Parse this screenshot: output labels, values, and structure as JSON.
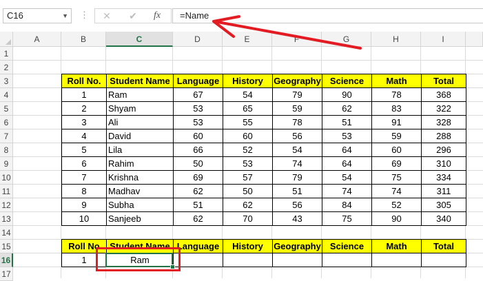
{
  "formula_bar": {
    "name_box": "C16",
    "name_box_dropdown_icon": "chevron-down-icon",
    "more_icon": "vertical-dots-icon",
    "cancel_icon": "close-icon",
    "enter_icon": "check-icon",
    "fx_label": "fx",
    "formula": "=Name"
  },
  "columns": [
    "A",
    "B",
    "C",
    "D",
    "E",
    "F",
    "G",
    "H",
    "I"
  ],
  "rows": [
    "1",
    "2",
    "3",
    "4",
    "5",
    "6",
    "7",
    "8",
    "9",
    "10",
    "11",
    "12",
    "13",
    "14",
    "15",
    "16",
    "17"
  ],
  "selected_cell": "C16",
  "table1": {
    "headers": [
      "Roll No.",
      "Student Name",
      "Language",
      "History",
      "Geography",
      "Science",
      "Math",
      "Total"
    ],
    "rows": [
      [
        "1",
        "Ram",
        "67",
        "54",
        "79",
        "90",
        "78",
        "368"
      ],
      [
        "2",
        "Shyam",
        "53",
        "65",
        "59",
        "62",
        "83",
        "322"
      ],
      [
        "3",
        "Ali",
        "53",
        "55",
        "78",
        "51",
        "91",
        "328"
      ],
      [
        "4",
        "David",
        "60",
        "60",
        "56",
        "53",
        "59",
        "288"
      ],
      [
        "5",
        "Lila",
        "66",
        "52",
        "54",
        "64",
        "60",
        "296"
      ],
      [
        "6",
        "Rahim",
        "50",
        "53",
        "74",
        "64",
        "69",
        "310"
      ],
      [
        "7",
        "Krishna",
        "69",
        "57",
        "79",
        "54",
        "75",
        "334"
      ],
      [
        "8",
        "Madhav",
        "62",
        "50",
        "51",
        "74",
        "74",
        "311"
      ],
      [
        "9",
        "Subha",
        "51",
        "62",
        "56",
        "84",
        "52",
        "305"
      ],
      [
        "10",
        "Sanjeeb",
        "62",
        "70",
        "43",
        "75",
        "90",
        "340"
      ]
    ]
  },
  "table2": {
    "headers": [
      "Roll No",
      "Student Name",
      "Language",
      "History",
      "Geography",
      "Science",
      "Math",
      "Total"
    ],
    "row": [
      "1",
      "Ram",
      "",
      "",
      "",
      "",
      "",
      ""
    ]
  },
  "colors": {
    "header_fill": "#ffff00",
    "selection_green": "#217346",
    "annotation_red": "#e31c23"
  }
}
